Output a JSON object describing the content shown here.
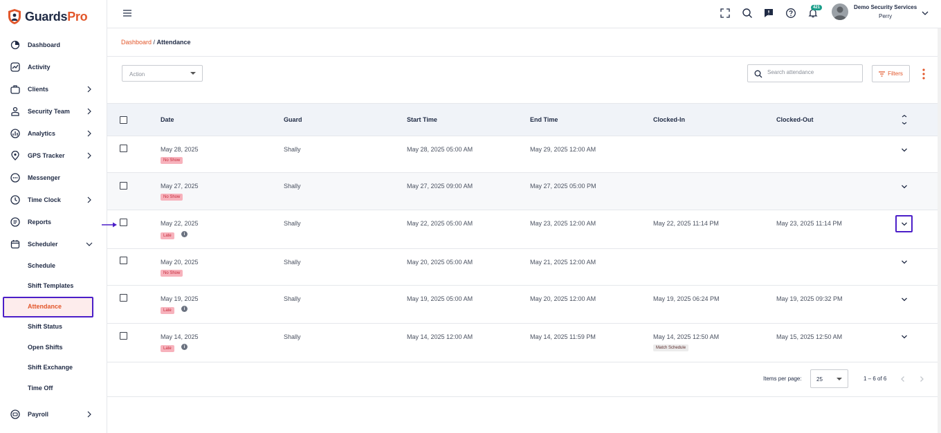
{
  "app": {
    "logo_main": "Guards",
    "logo_accent": "Pro"
  },
  "sidebar": {
    "items": [
      {
        "label": "Dashboard",
        "icon": "dashboard-icon"
      },
      {
        "label": "Activity",
        "icon": "activity-icon"
      },
      {
        "label": "Clients",
        "icon": "clients-icon"
      },
      {
        "label": "Security Team",
        "icon": "security-team-icon"
      },
      {
        "label": "Analytics",
        "icon": "analytics-icon"
      },
      {
        "label": "GPS Tracker",
        "icon": "gps-icon"
      },
      {
        "label": "Messenger",
        "icon": "messenger-icon"
      },
      {
        "label": "Time Clock",
        "icon": "time-clock-icon"
      },
      {
        "label": "Reports",
        "icon": "reports-icon"
      },
      {
        "label": "Scheduler",
        "icon": "scheduler-icon"
      }
    ],
    "scheduler_sub": [
      "Schedule",
      "Shift Templates",
      "Attendance",
      "Shift Status",
      "Open Shifts",
      "Shift Exchange",
      "Time Off"
    ],
    "payroll": {
      "label": "Payroll",
      "icon": "payroll-icon"
    }
  },
  "header": {
    "notification_count": "421",
    "user_name": "Demo Security Services",
    "user_sub": "Perry"
  },
  "breadcrumb": {
    "parent": "Dashboard",
    "separator": " / ",
    "current": "Attendance"
  },
  "toolbar": {
    "action_placeholder": "Action",
    "search_placeholder": "Search attendance",
    "filters_label": "Filters"
  },
  "table": {
    "columns": [
      "Date",
      "Guard",
      "Start Time",
      "End Time",
      "Clocked-In",
      "Clocked-Out"
    ],
    "rows": [
      {
        "date": "May 28, 2025",
        "status": "No Show",
        "guard": "Shally",
        "start": "May 28, 2025 05:00 AM",
        "end": "May 29, 2025 12:00 AM",
        "clock_in": "",
        "clock_out": "",
        "note": ""
      },
      {
        "date": "May 27, 2025",
        "status": "No Show",
        "guard": "Shally",
        "start": "May 27, 2025 09:00 AM",
        "end": "May 27, 2025 05:00 PM",
        "clock_in": "",
        "clock_out": "",
        "note": ""
      },
      {
        "date": "May 22, 2025",
        "status": "Late",
        "guard": "Shally",
        "start": "May 22, 2025 05:00 AM",
        "end": "May 23, 2025 12:00 AM",
        "clock_in": "May 22, 2025 11:14 PM",
        "clock_out": "May 23, 2025 11:14 PM",
        "note": ""
      },
      {
        "date": "May 20, 2025",
        "status": "No Show",
        "guard": "Shally",
        "start": "May 20, 2025 05:00 AM",
        "end": "May 21, 2025 12:00 AM",
        "clock_in": "",
        "clock_out": "",
        "note": ""
      },
      {
        "date": "May 19, 2025",
        "status": "Late",
        "guard": "Shally",
        "start": "May 19, 2025 05:00 AM",
        "end": "May 20, 2025 12:00 AM",
        "clock_in": "May 19, 2025 06:24 PM",
        "clock_out": "May 19, 2025 09:32 PM",
        "note": ""
      },
      {
        "date": "May 14, 2025",
        "status": "Late",
        "guard": "Shally",
        "start": "May 14, 2025 12:00 AM",
        "end": "May 14, 2025 11:59 PM",
        "clock_in": "May 14, 2025 12:50 AM",
        "clock_out": "May 15, 2025 12:50 AM",
        "note": "Match Schedule"
      }
    ]
  },
  "pagination": {
    "items_per_page_label": "Items per page:",
    "items_per_page": "25",
    "range": "1 – 6 of 6"
  },
  "colors": {
    "accent": "#e2572b",
    "highlight": "#4b1ec8",
    "navy": "#1f2a44"
  }
}
